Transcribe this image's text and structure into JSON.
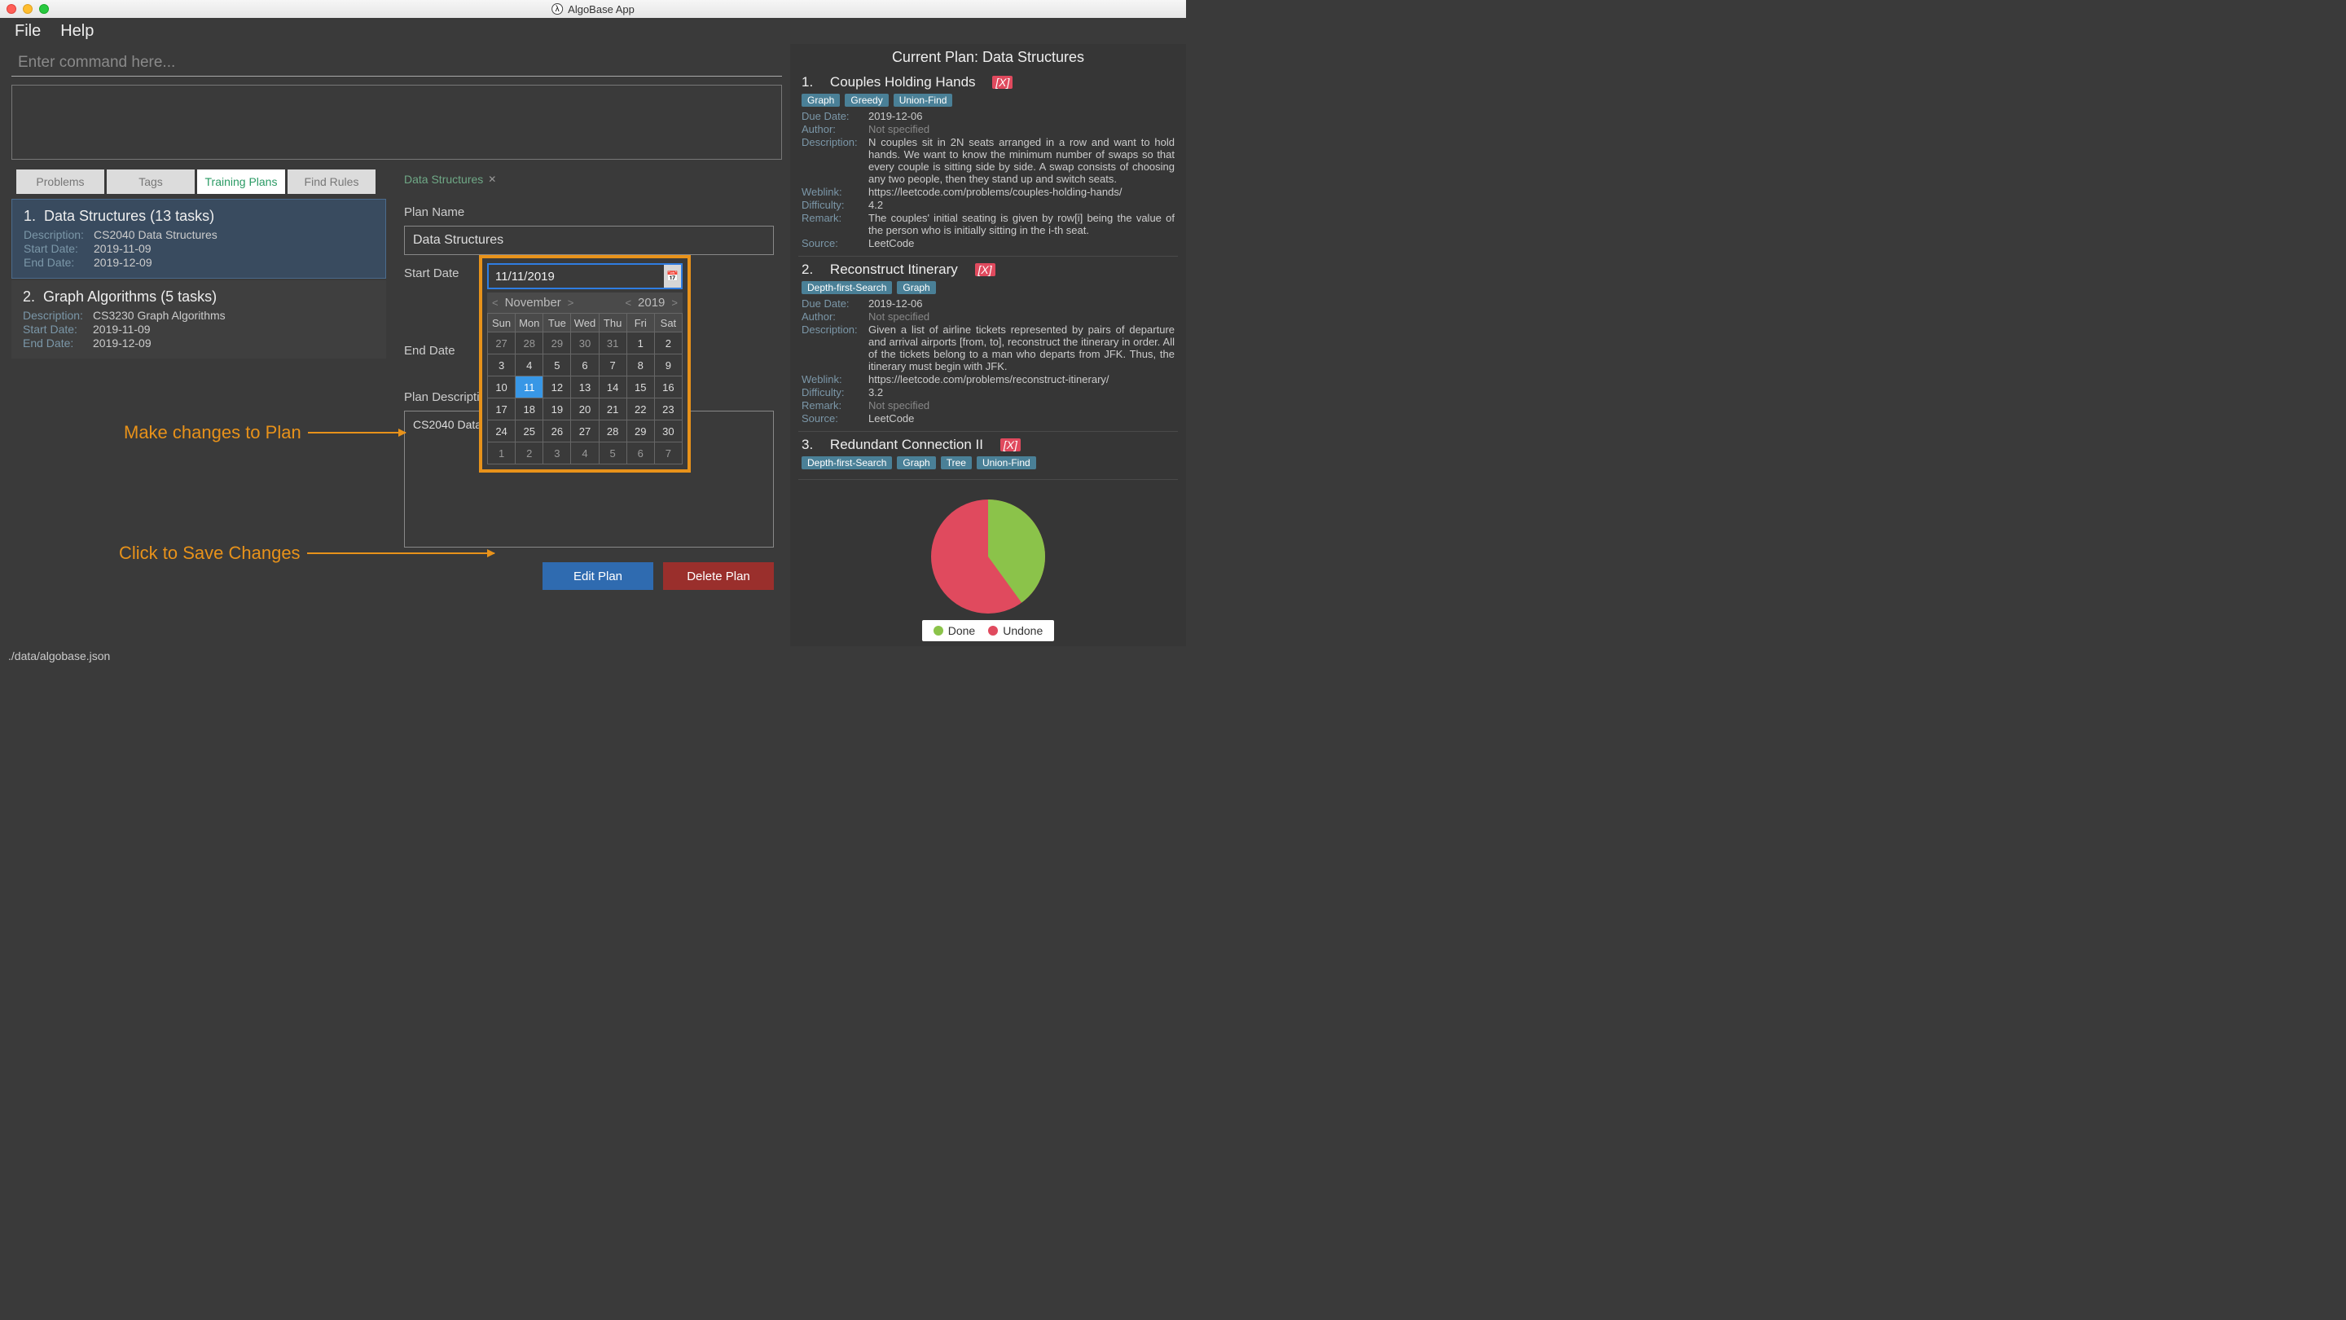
{
  "window": {
    "title": "AlgoBase App"
  },
  "menu": {
    "file": "File",
    "help": "Help"
  },
  "command": {
    "placeholder": "Enter command here..."
  },
  "tabs": {
    "problems": "Problems",
    "tags": "Tags",
    "training": "Training Plans",
    "rules": "Find Rules"
  },
  "plans": [
    {
      "idx": "1.",
      "title": "Data Structures (13 tasks)",
      "desc_label": "Description:",
      "desc": "CS2040 Data Structures",
      "start_label": "Start Date:",
      "start": "2019-11-09",
      "end_label": "End Date:",
      "end": "2019-12-09"
    },
    {
      "idx": "2.",
      "title": "Graph Algorithms (5 tasks)",
      "desc_label": "Description:",
      "desc": "CS3230 Graph Algorithms",
      "start_label": "Start Date:",
      "start": "2019-11-09",
      "end_label": "End Date:",
      "end": "2019-12-09"
    }
  ],
  "editor": {
    "tab": "Data Structures",
    "name_label": "Plan Name",
    "name_value": "Data Structures",
    "start_label": "Start Date",
    "end_label": "End Date",
    "desc_label": "Plan Description",
    "desc_value": "CS2040 Data S",
    "edit_btn": "Edit Plan",
    "delete_btn": "Delete Plan"
  },
  "datepicker": {
    "input": "11/11/2019",
    "month": "November",
    "year": "2019",
    "dows": [
      "Sun",
      "Mon",
      "Tue",
      "Wed",
      "Thu",
      "Fri",
      "Sat"
    ],
    "cells": [
      "27",
      "28",
      "29",
      "30",
      "31",
      "1",
      "2",
      "3",
      "4",
      "5",
      "6",
      "7",
      "8",
      "9",
      "10",
      "11",
      "12",
      "13",
      "14",
      "15",
      "16",
      "17",
      "18",
      "19",
      "20",
      "21",
      "22",
      "23",
      "24",
      "25",
      "26",
      "27",
      "28",
      "29",
      "30",
      "1",
      "2",
      "3",
      "4",
      "5",
      "6",
      "7"
    ],
    "selected_index": 15,
    "dim_start": [
      0,
      1,
      2,
      3,
      4
    ],
    "dim_end": [
      35,
      36,
      37,
      38,
      39,
      40,
      41
    ]
  },
  "annotations": {
    "make": "Make changes to Plan",
    "save": "Click to Save Changes"
  },
  "right": {
    "title": "Current Plan: Data Structures",
    "labels": {
      "due": "Due Date:",
      "author": "Author:",
      "desc": "Description:",
      "weblink": "Weblink:",
      "diff": "Difficulty:",
      "remark": "Remark:",
      "source": "Source:"
    },
    "problems": [
      {
        "n": "1.",
        "title": "Couples Holding Hands",
        "badge": "[X]",
        "tags": [
          "Graph",
          "Greedy",
          "Union-Find"
        ],
        "due": "2019-12-06",
        "author": "Not specified",
        "desc": "N couples sit in 2N seats arranged in a row and want to hold hands. We want to know the minimum number of swaps so that every couple is sitting side by side. A swap consists of choosing any two people, then they stand up and switch seats.",
        "weblink": "https://leetcode.com/problems/couples-holding-hands/",
        "diff": "4.2",
        "remark": "The couples' initial seating is given by row[i] being the value of the person who is initially sitting in the i-th seat.",
        "source": "LeetCode"
      },
      {
        "n": "2.",
        "title": "Reconstruct Itinerary",
        "badge": "[X]",
        "tags": [
          "Depth-first-Search",
          "Graph"
        ],
        "due": "2019-12-06",
        "author": "Not specified",
        "desc": "Given a list of airline tickets represented by pairs of departure and arrival airports [from, to], reconstruct the itinerary in order. All of the tickets belong to a man who departs from JFK. Thus, the itinerary must begin with JFK.",
        "weblink": "https://leetcode.com/problems/reconstruct-itinerary/",
        "diff": "3.2",
        "remark": "Not specified",
        "source": "LeetCode"
      },
      {
        "n": "3.",
        "title": "Redundant Connection II",
        "badge": "[X]",
        "tags": [
          "Depth-first-Search",
          "Graph",
          "Tree",
          "Union-Find"
        ]
      }
    ]
  },
  "chart_data": {
    "type": "pie",
    "series": [
      {
        "name": "Done",
        "value": 40,
        "color": "#8bc34a"
      },
      {
        "name": "Undone",
        "value": 60,
        "color": "#e04a5e"
      }
    ],
    "legend": {
      "done": "Done",
      "undone": "Undone"
    }
  },
  "statusbar": "./data/algobase.json"
}
